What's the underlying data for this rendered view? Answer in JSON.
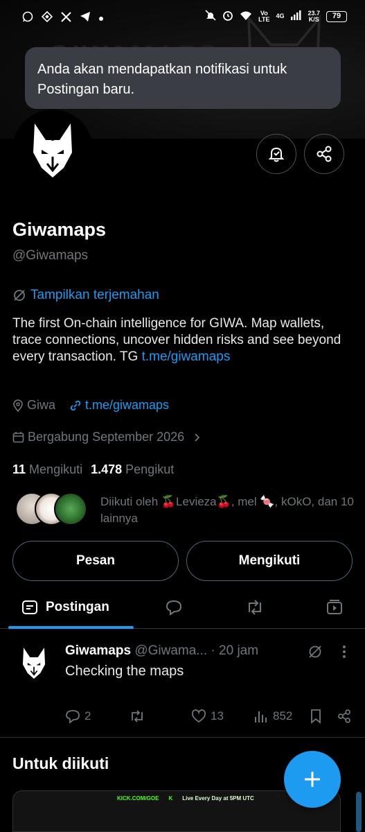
{
  "status_bar": {
    "network_vo": "Vo",
    "network_lte": "LTE",
    "network_4g": "4G",
    "speed_value": "23.7",
    "speed_unit": "K/S",
    "battery": "79"
  },
  "banner": {
    "watermark": "GIWAMAPS"
  },
  "toast": {
    "text": "Anda akan mendapatkan notifikasi untuk Postingan baru."
  },
  "profile": {
    "name": "Giwamaps",
    "handle": "@Giwamaps",
    "translate_label": "Tampilkan terjemahan",
    "bio_text": "The first On-chain intelligence for GIWA. Map wallets, trace connections, uncover hidden risks and see beyond every transaction. TG ",
    "bio_link": "t.me/giwamaps",
    "location": "Giwa",
    "website": "t.me/giwamaps",
    "joined": "Bergabung September 2026",
    "following_count": "11",
    "following_label": "Mengikuti",
    "followers_count": "1.478",
    "followers_label": "Pengikut",
    "followed_by": "Diikuti oleh 🍒Levieza🍒, mel 🍬, kOkO, dan 10 lainnya"
  },
  "buttons": {
    "message": "Pesan",
    "following": "Mengikuti"
  },
  "tabs": [
    {
      "label": "Postingan"
    }
  ],
  "post": {
    "author": "Giwamaps",
    "handle": "@Giwama...",
    "time": "· 20 jam",
    "text": "Checking the maps",
    "replies": "2",
    "likes": "13",
    "views": "852"
  },
  "suggestions": {
    "title": "Untuk diikuti",
    "card_strip_1": "KICK.COM/GOE",
    "card_strip_2": "K",
    "card_strip_3": "Live Every Day at 5PM UTC"
  },
  "colors": {
    "accent": "#1d9bf0",
    "muted": "#71767b",
    "toast_bg": "#3a3e44"
  }
}
